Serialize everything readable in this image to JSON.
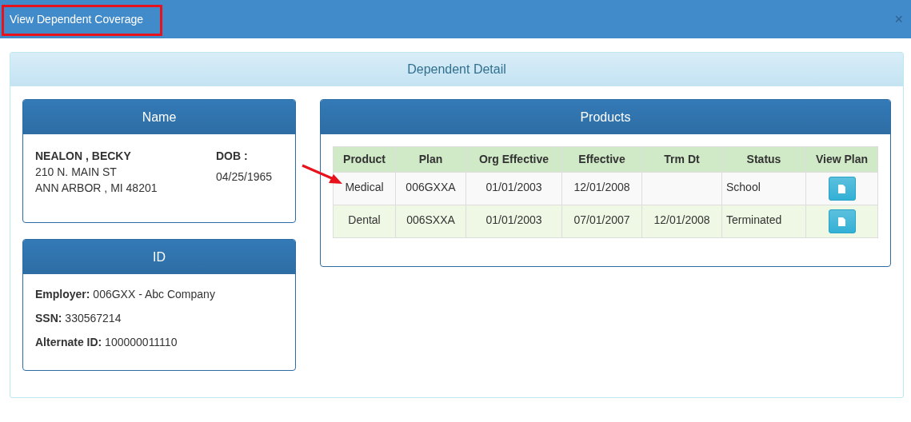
{
  "window": {
    "title": "View Dependent Coverage",
    "close": "×"
  },
  "panel": {
    "title": "Dependent Detail"
  },
  "name_card": {
    "title": "Name",
    "name": "NEALON , BECKY",
    "address": [
      "210 N. MAIN ST",
      "ANN ARBOR , MI 48201"
    ],
    "dob_label": "DOB :",
    "dob": "04/25/1965"
  },
  "id_card": {
    "title": "ID",
    "fields": [
      {
        "label": "Employer:",
        "value": "006GXX - Abc Company"
      },
      {
        "label": "SSN:",
        "value": "330567214"
      },
      {
        "label": "Alternate ID:",
        "value": "100000011110"
      }
    ]
  },
  "products": {
    "title": "Products",
    "columns": [
      "Product",
      "Plan",
      "Org Effective",
      "Effective",
      "Trm Dt",
      "Status",
      "View Plan"
    ],
    "rows": [
      {
        "cells": [
          "Medical",
          "006GXXA",
          "01/01/2003",
          "12/01/2008",
          "",
          "School"
        ]
      },
      {
        "cells": [
          "Dental",
          "006SXXA",
          "01/01/2003",
          "07/01/2007",
          "12/01/2008",
          "Terminated"
        ]
      }
    ]
  }
}
